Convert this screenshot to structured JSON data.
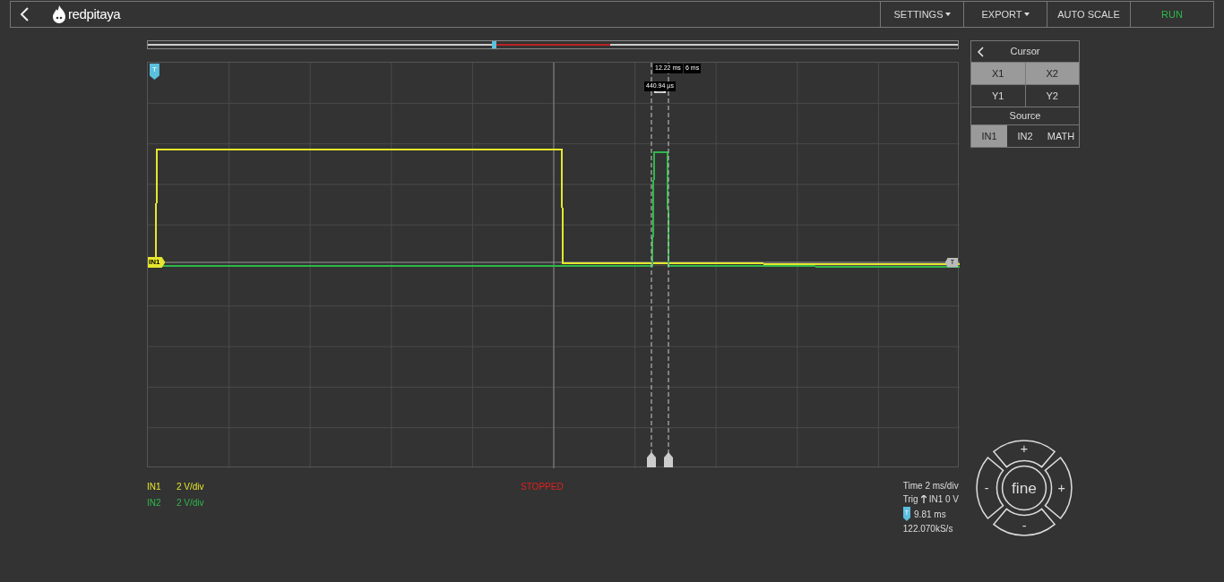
{
  "toolbar": {
    "menus": [
      {
        "label": "SETTINGS",
        "dropdown": true
      },
      {
        "label": "EXPORT",
        "dropdown": true
      },
      {
        "label": "AUTO SCALE",
        "dropdown": false
      },
      {
        "label": "RUN",
        "dropdown": false
      }
    ],
    "logo": "redpitaya"
  },
  "timeline": {
    "level": 0.425
  },
  "plot": {
    "trigger_badge": "T",
    "channel_badge": "IN1",
    "level_badge": "T",
    "cursor_x1_label": "12.22 ms",
    "cursor_x2_label": "6 ms",
    "cursor_delta": "440.94 µs"
  },
  "channels": [
    {
      "name": "IN1",
      "scale": "2 V/div",
      "color": "#e6e62e"
    },
    {
      "name": "IN2",
      "scale": "2 V/div",
      "color": "#2eb84a"
    }
  ],
  "status": "STOPPED",
  "info": {
    "time": "Time 2 ms/div",
    "trig": "Trig",
    "trig_source": "IN1 0 V",
    "trig_badge": "T",
    "trig_delay": "9.81 ms",
    "sample_rate": "122.070kS/s"
  },
  "cursor_panel": {
    "title": "Cursor",
    "cursors": [
      {
        "label": "X1",
        "selected": true
      },
      {
        "label": "X2",
        "selected": true
      },
      {
        "label": "Y1",
        "selected": false
      },
      {
        "label": "Y2",
        "selected": false
      }
    ],
    "source_title": "Source",
    "sources": [
      {
        "label": "IN1",
        "selected": true
      },
      {
        "label": "IN2",
        "selected": false
      },
      {
        "label": "MATH",
        "selected": false
      }
    ]
  },
  "dial": {
    "center": "fine",
    "up": "+",
    "down": "-",
    "left": "-",
    "right": "+"
  }
}
